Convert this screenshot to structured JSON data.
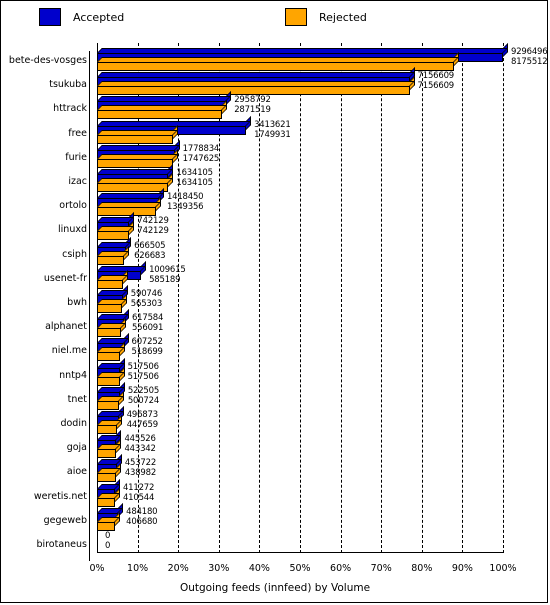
{
  "legend": {
    "accepted": {
      "label": "Accepted",
      "color": "#0000cc"
    },
    "rejected": {
      "label": "Rejected",
      "color": "#ffa500"
    }
  },
  "axis": {
    "x_title": "Outgoing feeds (innfeed) by Volume",
    "x_ticks": [
      "0%",
      "10%",
      "20%",
      "30%",
      "40%",
      "50%",
      "60%",
      "70%",
      "80%",
      "90%",
      "100%"
    ]
  },
  "chart_data": {
    "type": "bar",
    "orientation": "horizontal",
    "title": "",
    "xlabel": "Outgoing feeds (innfeed) by Volume",
    "ylabel": "",
    "xlim": [
      0,
      100
    ],
    "xticks": [
      0,
      10,
      20,
      30,
      40,
      50,
      60,
      70,
      80,
      90,
      100
    ],
    "xtick_labels": [
      "0%",
      "10%",
      "20%",
      "30%",
      "40%",
      "50%",
      "60%",
      "70%",
      "80%",
      "90%",
      "100%"
    ],
    "grid": true,
    "legend_position": "top",
    "units": "bytes",
    "scale_max_value": 9296496,
    "categories": [
      "bete-des-vosges",
      "tsukuba",
      "httrack",
      "free",
      "furie",
      "izac",
      "ortolo",
      "linuxd",
      "csiph",
      "usenet-fr",
      "bwh",
      "alphanet",
      "niel.me",
      "nntp4",
      "tnet",
      "dodin",
      "goja",
      "aioe",
      "weretis.net",
      "gegeweb",
      "birotaneus"
    ],
    "series": [
      {
        "name": "Accepted",
        "color": "#0000cc",
        "values": [
          9296496,
          7156609,
          2958792,
          3413621,
          1778834,
          1634105,
          1418450,
          742129,
          666505,
          1009615,
          590746,
          617584,
          607252,
          517506,
          522505,
          496873,
          445526,
          453722,
          411272,
          484180,
          0
        ],
        "labels": [
          "9296496",
          "7156609",
          "2958792",
          "3413621",
          "1778834",
          "1634105",
          "1418450",
          "742129",
          "666505",
          "1009615",
          "590746",
          "617584",
          "607252",
          "517506",
          "522505",
          "496873",
          "445526",
          "453722",
          "411272",
          "484180",
          "0"
        ]
      },
      {
        "name": "Rejected",
        "color": "#ffa500",
        "values": [
          8175512,
          7156609,
          2871519,
          1749931,
          1747625,
          1634105,
          1349356,
          742129,
          626683,
          585189,
          565303,
          556091,
          518699,
          517506,
          500724,
          447659,
          443342,
          438982,
          410544,
          406680,
          0
        ],
        "labels": [
          "8175512",
          "7156609",
          "2871519",
          "1749931",
          "1747625",
          "1634105",
          "1349356",
          "742129",
          "626683",
          "585189",
          "565303",
          "556091",
          "518699",
          "517506",
          "500724",
          "447659",
          "443342",
          "438982",
          "410544",
          "406680",
          "0"
        ]
      }
    ]
  }
}
